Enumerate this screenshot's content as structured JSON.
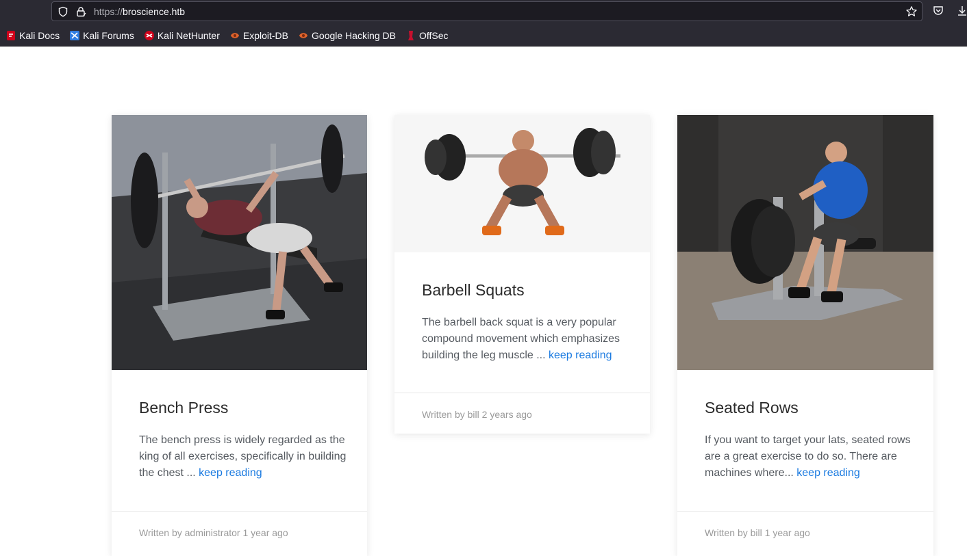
{
  "browser": {
    "url_protocol": "https://",
    "url_host": "broscience.htb",
    "bookmarks": [
      {
        "label": "Kali Docs",
        "icon": "kali-docs-icon",
        "color": "#d0021b"
      },
      {
        "label": "Kali Forums",
        "icon": "kali-forums-icon",
        "color": "#2f7de1"
      },
      {
        "label": "Kali NetHunter",
        "icon": "kali-nethunter-icon",
        "color": "#d0021b"
      },
      {
        "label": "Exploit-DB",
        "icon": "exploit-db-icon",
        "color": "#e0632b"
      },
      {
        "label": "Google Hacking DB",
        "icon": "ghdb-icon",
        "color": "#e0632b"
      },
      {
        "label": "OffSec",
        "icon": "offsec-icon",
        "color": "#c8102e"
      }
    ]
  },
  "posts": [
    {
      "title": "Bench Press",
      "excerpt": "The bench press is widely regarded as the king of all exercises, specifically in building the chest ... ",
      "link": "keep reading",
      "footer": "Written by administrator 1 year ago",
      "image": "bench-press-photo"
    },
    {
      "title": "Barbell Squats",
      "excerpt": "The barbell back squat is a very popular compound movement which emphasizes building the leg muscle ... ",
      "link": "keep reading",
      "footer": "Written by bill 2 years ago",
      "image": "barbell-squat-photo"
    },
    {
      "title": "Seated Rows",
      "excerpt": "If you want to target your lats, seated rows are a great exercise to do so. There are machines where... ",
      "link": "keep reading",
      "footer": "Written by bill 1 year ago",
      "image": "seated-rows-photo"
    }
  ],
  "colors": {
    "link": "#1a7ae0",
    "title": "#2b2b2b",
    "chrome_bg": "#2b2a33"
  }
}
